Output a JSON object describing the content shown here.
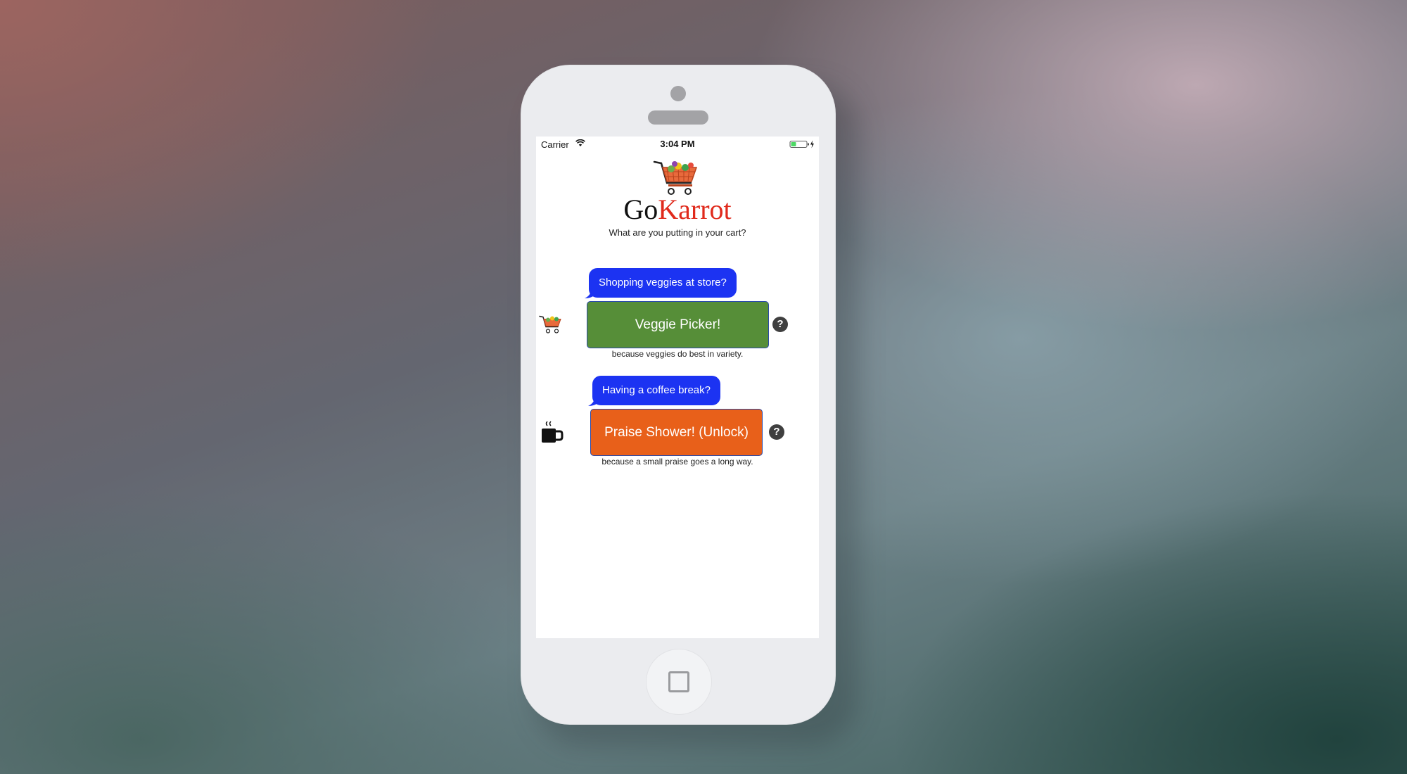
{
  "status_bar": {
    "carrier": "Carrier",
    "time": "3:04 PM",
    "wifi_icon": "wifi-icon",
    "battery_icon": "battery-charging-icon",
    "battery_color": "#4cd964"
  },
  "logo": {
    "icon": "shopping-cart-icon",
    "brand_part_1": "Go",
    "brand_part_2": "Karrot",
    "brand_color_1": "#111111",
    "brand_color_2": "#e02a1c"
  },
  "tagline": "What are you putting in your cart?",
  "actions": [
    {
      "prompt": "Shopping veggies at store?",
      "button_label": "Veggie Picker!",
      "button_color": "#568e38",
      "caption": "because veggies do best in variety.",
      "help_label": "?",
      "icon": "shopping-cart-icon"
    },
    {
      "prompt": "Having a coffee break?",
      "button_label": "Praise Shower! (Unlock)",
      "button_color": "#e8601a",
      "caption": "because a small praise goes a long way.",
      "help_label": "?",
      "icon": "coffee-mug-icon"
    }
  ],
  "colors": {
    "bubble": "#1c33f2",
    "help_icon": "#3f3f3f"
  },
  "device": {
    "home_button_icon": "home-square-icon"
  }
}
